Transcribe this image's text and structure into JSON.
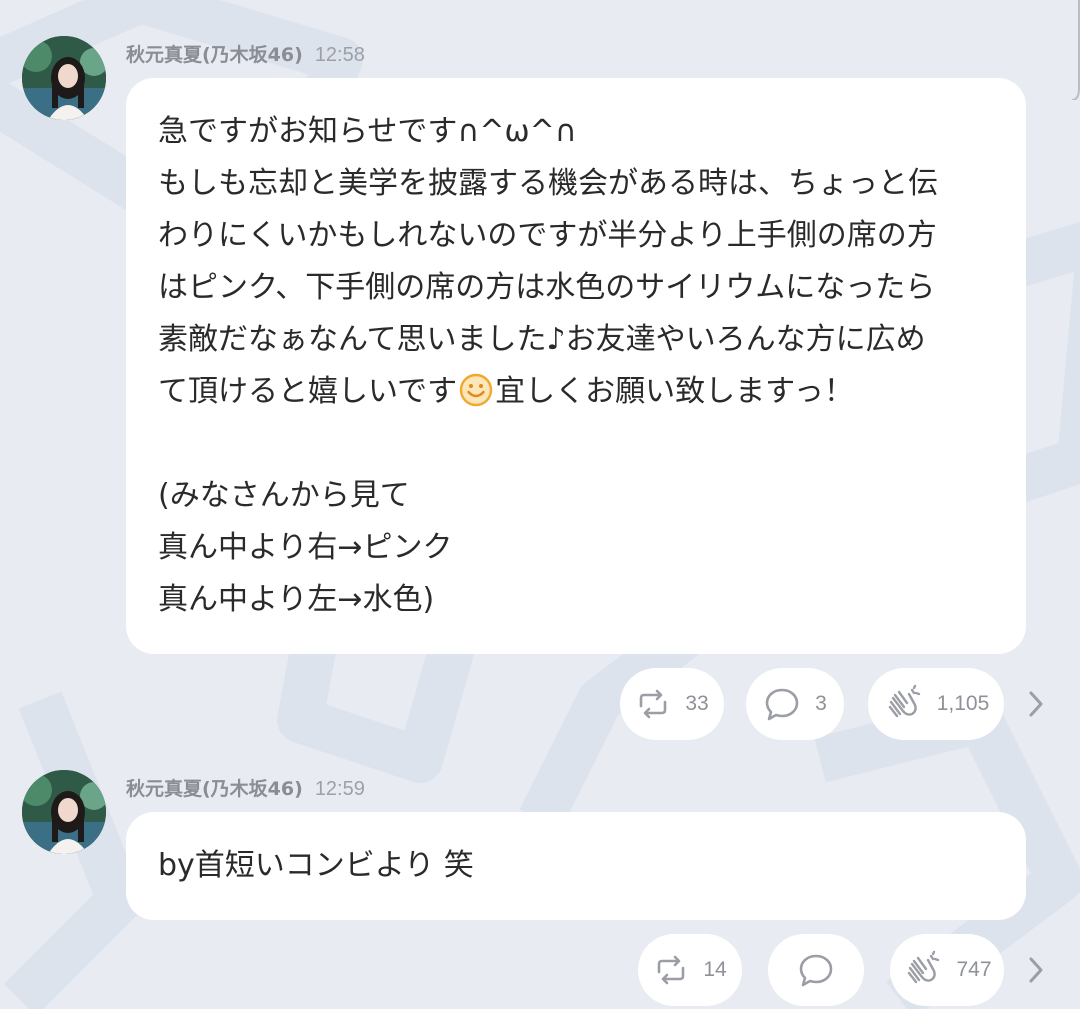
{
  "posts": [
    {
      "author": "秋元真夏(乃木坂46)",
      "time": "12:58",
      "lines": [
        "急ですがお知らせです∩^ω^∩",
        "もしも忘却と美学を披露する機会がある時は、ちょっと伝",
        "わりにくいかもしれないのですが半分より上手側の席の方",
        "はピンク、下手側の席の方は水色のサイリウムになったら",
        "素敵だなぁなんて思いました♪お友達やいろんな方に広め",
        "",
        "",
        "(みなさんから見て",
        "真ん中より右→ピンク",
        "真ん中より左→水色)"
      ],
      "line6_before_emoji": "て頂けると嬉しいです",
      "line6_after_emoji": "宜しくお願い致しますっ！",
      "emoji_icon": "smiling-face-emoji",
      "retweets": "33",
      "replies": "3",
      "claps": "1,105"
    },
    {
      "author": "秋元真夏(乃木坂46)",
      "time": "12:59",
      "lines": [
        "by首短いコンビより 笑"
      ],
      "retweets": "14",
      "replies": "",
      "claps": "747"
    }
  ],
  "icons": {
    "retweet": "retweet-icon",
    "reply": "comment-bubble-icon",
    "clap": "clapping-hands-icon",
    "more": "chevron-right-icon"
  },
  "colors": {
    "background": "#e8ecf2",
    "bubble": "#ffffff",
    "text": "#2a2a2a",
    "meta": "#8a8d94",
    "icon": "#9b9ea5"
  }
}
